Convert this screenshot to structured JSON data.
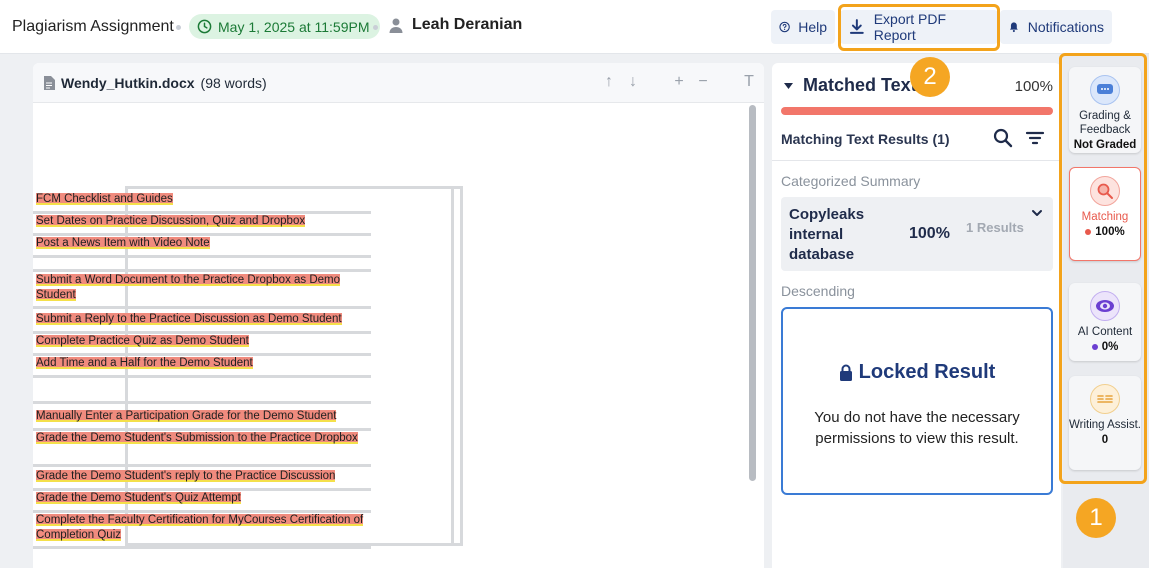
{
  "header": {
    "title": "Plagiarism Assignment",
    "due_date": "May 1, 2025 at 11:59PM",
    "user_name": "Leah Deranian",
    "help_label": "Help",
    "export_label": "Export PDF Report",
    "notifications_label": "Notifications"
  },
  "document": {
    "filename": "Wendy_Hutkin.docx",
    "word_count": "(98 words)",
    "rows": [
      "FCM Checklist and Guides",
      "Set Dates on Practice Discussion, Quiz and Dropbox",
      "Post a News Item with Video Note",
      "",
      "Submit a Word Document to the Practice Dropbox as Demo Student",
      "Submit a Reply to the Practice Discussion as Demo Student",
      "Complete Practice Quiz as Demo Student",
      "Add Time and a Half for the Demo Student",
      "",
      "Manually Enter a Participation Grade for the Demo Student",
      "Grade the Demo Student's Submission to the Practice Dropbox",
      "Grade the Demo Student's reply to the Practice Discussion",
      "Grade the Demo Student's Quiz Attempt",
      "Complete the Faculty Certification for MyCourses Certification of Completion Quiz"
    ]
  },
  "matched": {
    "title": "Matched Text",
    "percent": "100%",
    "results_label": "Matching Text Results",
    "results_count": "(1)",
    "categorized_label": "Categorized Summary",
    "source_name": "Copyleaks internal database",
    "source_percent": "100%",
    "source_results": "1 Results",
    "sort_label": "Descending",
    "locked_title": "Locked Result",
    "locked_desc": "You do not have the necessary permissions to view this result."
  },
  "rail": {
    "grading_label": "Grading & Feedback",
    "grading_value": "Not Graded",
    "matching_label": "Matching",
    "matching_value": "100%",
    "ai_label": "AI Content",
    "ai_value": "0%",
    "writing_label": "Writing Assist.",
    "writing_value": "0"
  },
  "callouts": {
    "one": "1",
    "two": "2"
  },
  "colors": {
    "highlight": "#f08b7e",
    "highlight_underline": "#f4e04a",
    "accent_orange": "#f3a31b",
    "matching_red": "#e8594c",
    "ai_purple": "#6b3fd1",
    "link_blue": "#1f3a7a"
  }
}
